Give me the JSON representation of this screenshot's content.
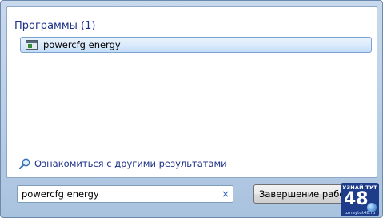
{
  "results": {
    "section_title": "Программы (1)",
    "items": [
      {
        "label": "powercfg energy",
        "icon": "console-app-icon"
      }
    ],
    "more_results_label": "Ознакомиться с другими результатами",
    "more_results_icon": "search-icon"
  },
  "search": {
    "value": "powercfg energy",
    "clear_icon": "×"
  },
  "shutdown": {
    "label": "Завершение работы"
  },
  "watermark": {
    "top_text": "УЗНАЙ ТУТ",
    "number": "48",
    "bottom_text": "uznaytut48.ru"
  },
  "colors": {
    "accent": "#1e3287",
    "selection_border": "#7da2ce",
    "frame": "#b7cde6"
  }
}
